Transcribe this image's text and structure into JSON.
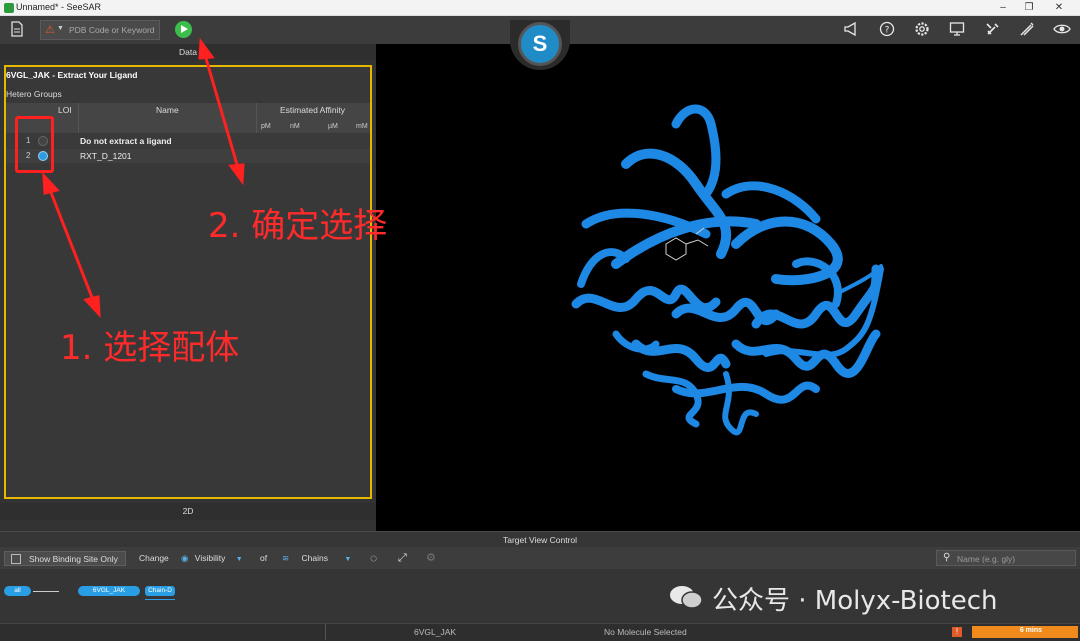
{
  "window": {
    "title": "Unnamed* - SeeSAR",
    "controls": [
      "–",
      "❐",
      "✕"
    ]
  },
  "toolbar": {
    "search_placeholder": "PDB Code or Keyword",
    "right_icons": [
      "megaphone-icon",
      "help-icon",
      "settings-icon",
      "monitor-icon",
      "tools-icon",
      "tweezers-icon",
      "eye-icon"
    ]
  },
  "logo": {
    "glyph": "S"
  },
  "left_panel": {
    "header": "Data",
    "title": "6VGL_JAK - Extract Your Ligand",
    "section": "Hetero Groups",
    "columns": {
      "loi": "LOI",
      "name": "Name",
      "affinity": "Estimated Affinity"
    },
    "units": [
      "pM",
      "nM",
      "µM",
      "mM"
    ],
    "rows": [
      {
        "num": "1",
        "name": "Do not extract a ligand",
        "selected": false
      },
      {
        "num": "2",
        "name": "RXT_D_1201",
        "selected": true
      }
    ],
    "tab_2d": "2D"
  },
  "annotations": {
    "step1": "1. 选择配体",
    "step2": "2. 确定选择"
  },
  "target_view_control": {
    "header": "Target View Control",
    "show_binding_site": "Show Binding Site Only",
    "change": "Change",
    "visibility": "Visibility",
    "of": "of",
    "chains": "Chains",
    "search_placeholder": "Name (e.g. gly)",
    "pills": {
      "all": "all",
      "structure": "6VGL_JAK",
      "chain": "Chain-D"
    }
  },
  "status": {
    "structure": "6VGL_JAK",
    "molecule": "No Molecule Selected",
    "warning": "!",
    "progress_label": "6 mins"
  },
  "watermark": {
    "text": "公众号 · Molyx-Biotech"
  },
  "colors": {
    "accent": "#2a9ee4",
    "highlight": "#e6b800",
    "annotation": "#ff2a2a",
    "protein": "#1e88e5",
    "go": "#3bbf4a"
  }
}
